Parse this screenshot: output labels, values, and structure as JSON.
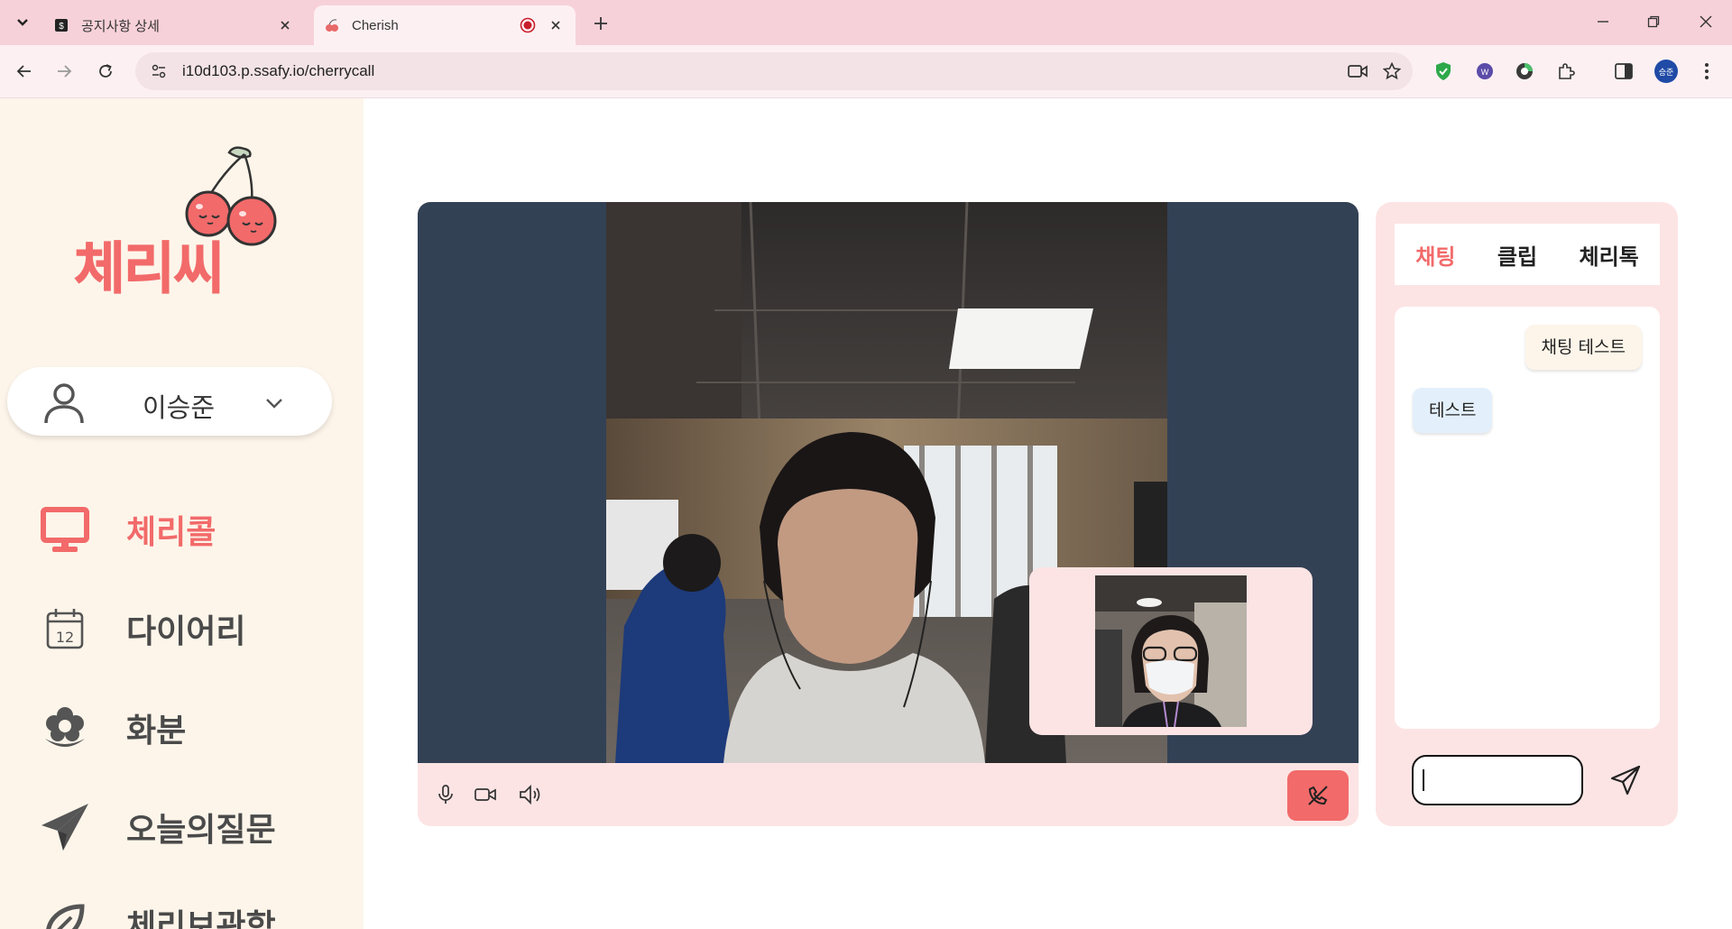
{
  "browser": {
    "tabs": [
      {
        "title": "공지사항 상세",
        "active": false
      },
      {
        "title": "Cherish",
        "active": true,
        "recording": true
      }
    ],
    "url": "i10d103.p.ssafy.io/cherrycall",
    "profile_initials": "승준"
  },
  "sidebar": {
    "logo_text": "체리씨",
    "user": {
      "name": "이승준"
    },
    "nav": [
      {
        "label": "체리콜",
        "icon": "monitor-icon",
        "active": true
      },
      {
        "label": "다이어리",
        "icon": "calendar-icon",
        "active": false
      },
      {
        "label": "화분",
        "icon": "flower-icon",
        "active": false
      },
      {
        "label": "오늘의질문",
        "icon": "paper-plane-icon",
        "active": false
      },
      {
        "label": "체리보관함",
        "icon": "sprout-icon",
        "active": false
      }
    ],
    "calendar_day": "12"
  },
  "video": {
    "controls": [
      "microphone-icon",
      "camera-icon",
      "speaker-icon"
    ],
    "hangup_icon": "phone-hangup-icon"
  },
  "chat": {
    "tabs": [
      {
        "label": "채팅",
        "active": true
      },
      {
        "label": "클립",
        "active": false
      },
      {
        "label": "체리톡",
        "active": false
      }
    ],
    "messages": [
      {
        "text": "채팅 테스트",
        "from": "me"
      },
      {
        "text": "테스트",
        "from": "other"
      }
    ],
    "input_value": ""
  },
  "colors": {
    "accent": "#f26a6a",
    "sidebar_bg": "#fdf5ea",
    "panel_bg": "#fde4e4",
    "video_bg": "#334155",
    "tabstrip_bg": "#f7d1d9"
  }
}
